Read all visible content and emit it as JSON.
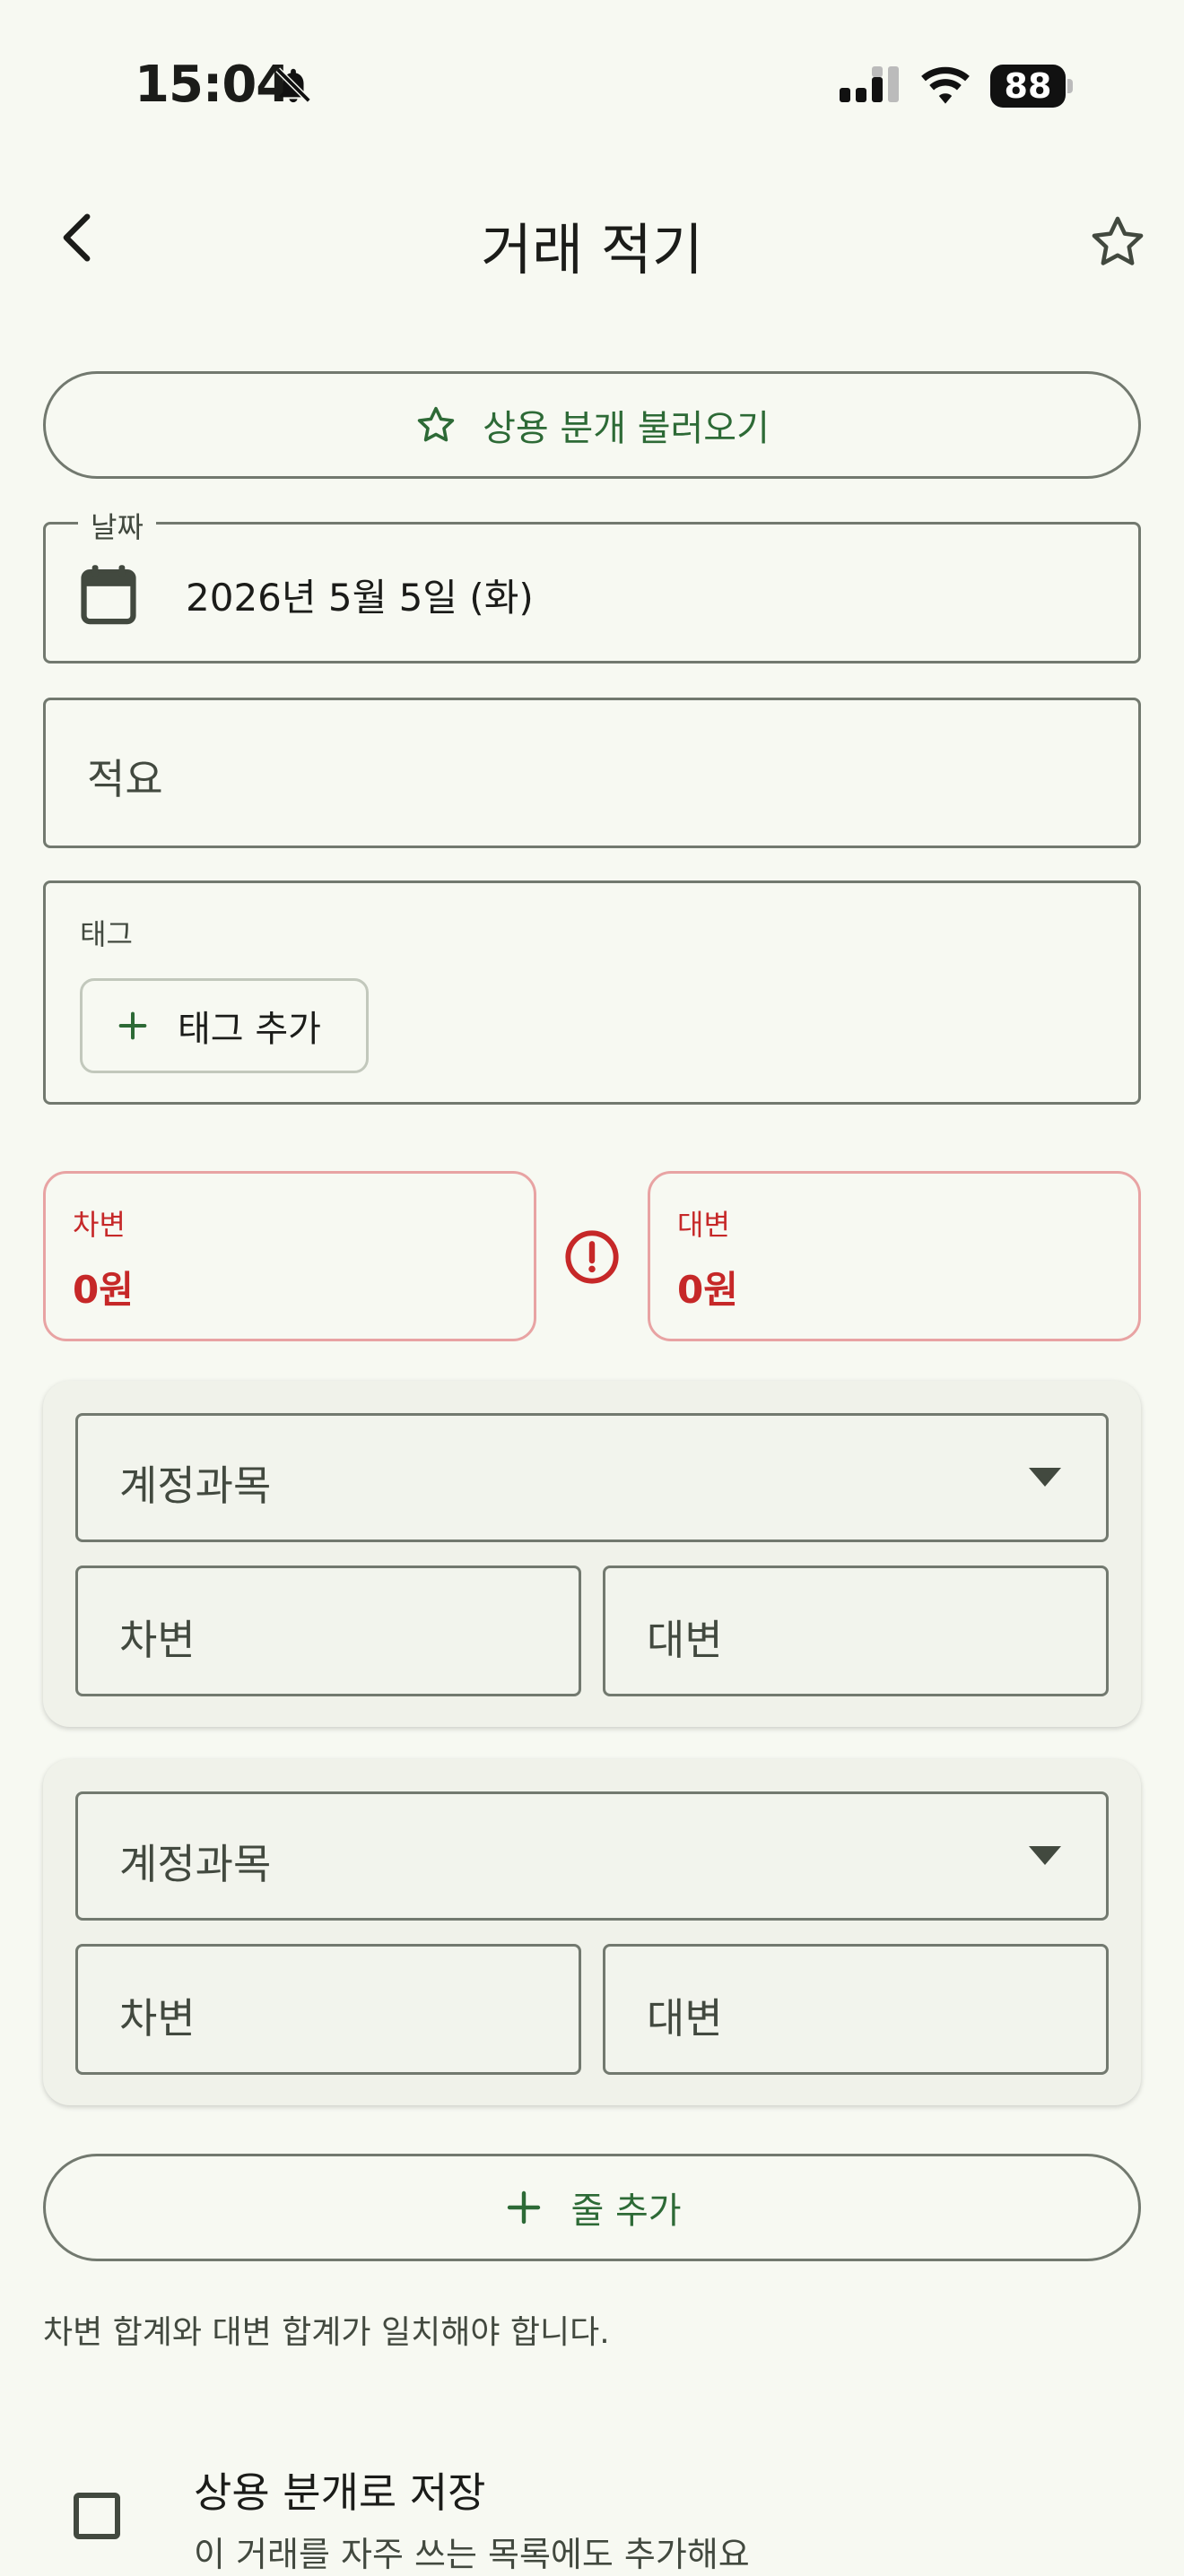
{
  "status_bar": {
    "time": "15:04",
    "battery": "88"
  },
  "header": {
    "title": "거래 적기"
  },
  "load_favorite": {
    "label": "상용 분개 불러오기"
  },
  "date_field": {
    "label": "날짜",
    "value": "2026년 5월 5일 (화)"
  },
  "memo_field": {
    "placeholder": "적요"
  },
  "tags": {
    "label": "태그",
    "add_label": "태그 추가"
  },
  "totals": {
    "debit_label": "차변",
    "debit_value": "0원",
    "credit_label": "대변",
    "credit_value": "0원"
  },
  "entries": [
    {
      "account_placeholder": "계정과목",
      "debit_placeholder": "차변",
      "credit_placeholder": "대변"
    },
    {
      "account_placeholder": "계정과목",
      "debit_placeholder": "차변",
      "credit_placeholder": "대변"
    }
  ],
  "add_line": {
    "label": "줄 추가"
  },
  "hint": "차변 합계와 대변 합계가 일치해야 합니다.",
  "save_favorite": {
    "label": "상용 분개로 저장",
    "sublabel": "이 거래를 자주 쓰는 목록에도 추가해요"
  },
  "colors": {
    "background": "#f7f9f2",
    "primary": "#2d6a36",
    "error": "#c62828",
    "outline": "#72796f"
  }
}
